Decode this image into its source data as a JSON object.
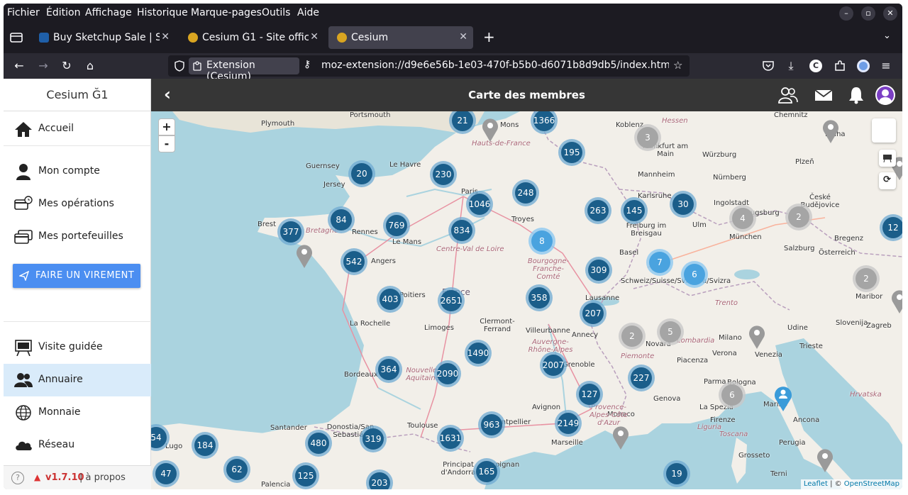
{
  "browser": {
    "menus": [
      "Fichier",
      "Édition",
      "Affichage",
      "Historique",
      "Marque-pages",
      "Outils",
      "Aide"
    ],
    "tabs": [
      {
        "title": "Buy Sketchup Sale | Sketc",
        "favicon_color": "#1f5fa8"
      },
      {
        "title": "Cesium Ğ1 - Site officiel",
        "favicon_color": "#d9a521"
      },
      {
        "title": "Cesium",
        "favicon_color": "#d9a521"
      }
    ],
    "extension_label": "Extension (Cesium)",
    "url": "moz-extension://d9e6e56b-1e03-470f-b5b0-d6071b8d9db5/index.html#/app"
  },
  "sidebar": {
    "title": "Cesium Ğ1",
    "items": [
      {
        "label": "Accueil",
        "icon": "home-icon"
      },
      {
        "label": "Mon compte",
        "icon": "person-icon"
      },
      {
        "label": "Mes opérations",
        "icon": "card-clock-icon"
      },
      {
        "label": "Mes portefeuilles",
        "icon": "wallets-icon"
      },
      {
        "label": "Visite guidée",
        "icon": "easel-icon"
      },
      {
        "label": "Annuaire",
        "icon": "people-icon"
      },
      {
        "label": "Monnaie",
        "icon": "globe-icon"
      },
      {
        "label": "Réseau",
        "icon": "cloud-icon"
      }
    ],
    "transfer_button": "FAIRE UN VIREMENT",
    "version": "v1.7.10",
    "about": "| à propos"
  },
  "header": {
    "title": "Carte des membres"
  },
  "map": {
    "zoom_in": "+",
    "zoom_out": "-",
    "attribution_leaflet": "Leaflet",
    "attribution_sep": " | © ",
    "attribution_osm": "OpenStreetMap",
    "clusters": [
      {
        "n": "21",
        "c": "blue"
      },
      {
        "n": "1366",
        "c": "blue"
      },
      {
        "n": "195",
        "c": "blue"
      },
      {
        "n": "3",
        "c": "grey"
      },
      {
        "n": "20",
        "c": "blue"
      },
      {
        "n": "230",
        "c": "blue"
      },
      {
        "n": "248",
        "c": "blue"
      },
      {
        "n": "1046",
        "c": "blue"
      },
      {
        "n": "263",
        "c": "blue"
      },
      {
        "n": "145",
        "c": "blue"
      },
      {
        "n": "30",
        "c": "blue"
      },
      {
        "n": "4",
        "c": "grey"
      },
      {
        "n": "2",
        "c": "grey"
      },
      {
        "n": "12",
        "c": "blue"
      },
      {
        "n": "84",
        "c": "blue"
      },
      {
        "n": "377",
        "c": "blue"
      },
      {
        "n": "769",
        "c": "blue"
      },
      {
        "n": "834",
        "c": "blue"
      },
      {
        "n": "8",
        "c": "light"
      },
      {
        "n": "542",
        "c": "blue"
      },
      {
        "n": "309",
        "c": "blue"
      },
      {
        "n": "7",
        "c": "light"
      },
      {
        "n": "6",
        "c": "light"
      },
      {
        "n": "2",
        "c": "grey"
      },
      {
        "n": "403",
        "c": "blue"
      },
      {
        "n": "2651",
        "c": "blue"
      },
      {
        "n": "358",
        "c": "blue"
      },
      {
        "n": "207",
        "c": "blue"
      },
      {
        "n": "2",
        "c": "grey"
      },
      {
        "n": "5",
        "c": "grey"
      },
      {
        "n": "1490",
        "c": "blue"
      },
      {
        "n": "364",
        "c": "blue"
      },
      {
        "n": "2090",
        "c": "blue"
      },
      {
        "n": "2007",
        "c": "blue"
      },
      {
        "n": "227",
        "c": "blue"
      },
      {
        "n": "127",
        "c": "blue"
      },
      {
        "n": "6",
        "c": "grey"
      },
      {
        "n": "963",
        "c": "blue"
      },
      {
        "n": "2149",
        "c": "blue"
      },
      {
        "n": "1631",
        "c": "blue"
      },
      {
        "n": "319",
        "c": "blue"
      },
      {
        "n": "480",
        "c": "blue"
      },
      {
        "n": "184",
        "c": "blue"
      },
      {
        "n": "54",
        "c": "blue"
      },
      {
        "n": "62",
        "c": "blue"
      },
      {
        "n": "47",
        "c": "blue"
      },
      {
        "n": "125",
        "c": "blue"
      },
      {
        "n": "203",
        "c": "blue"
      },
      {
        "n": "165",
        "c": "blue"
      },
      {
        "n": "19",
        "c": "blue"
      }
    ],
    "cities": [
      "Portsmouth",
      "Plymouth",
      "Mons",
      "Hauts-de-France",
      "Koblenz",
      "Hessen",
      "Chemnitz",
      "Praha",
      "Frankfurt am Main",
      "Würzburg",
      "Plzeň",
      "Guernsey",
      "Le Havre",
      "Jersey",
      "Paris",
      "Mannheim",
      "Nürnberg",
      "Karlsruhe",
      "Brest",
      "Rennes",
      "Bretagne",
      "Troyes",
      "Ingolstadt",
      "Freiburg im Breisgau",
      "Ulm",
      "Augsburg",
      "České Budějovice",
      "Le Mans",
      "Centre-Val de Loire",
      "Angers",
      "München",
      "Salzburg",
      "Österreich",
      "Basel",
      "Bourgogne-Franche-Comté",
      "Schweiz/Suisse/Svizzera/Svizra",
      "Lausanne",
      "Poitiers",
      "La Rochelle",
      "Limoges",
      "Clermont-Ferrand",
      "Villeurbanne",
      "Annecy",
      "Novara",
      "Slovenija",
      "Zagreb",
      "Udine",
      "Trieste",
      "Venezia",
      "Verona",
      "Piacenza",
      "Bordeaux",
      "Nouvelle-Aquitaine",
      "Grenoble",
      "Genova",
      "Parma",
      "Bologna",
      "Auvergne-Rhône-Alpes",
      "Avignon",
      "Monaco",
      "Provence-Alpes-Côte d'Azur",
      "La Spezia",
      "Firenze",
      "Toscana",
      "Ancona",
      "Marino",
      "Hrvatska",
      "Montpellier",
      "Toulouse",
      "Marseille",
      "Santander",
      "Donostia/San Sebastián",
      "Lugo",
      "Principat d'Andorra",
      "Perpignan",
      "Grosseto",
      "Terni",
      "Perugia",
      "Palencia",
      "Maribor",
      "Trento",
      "Milano",
      "Bregenz",
      "Lombardia",
      "Piemonte",
      "France",
      "Liguria"
    ]
  }
}
